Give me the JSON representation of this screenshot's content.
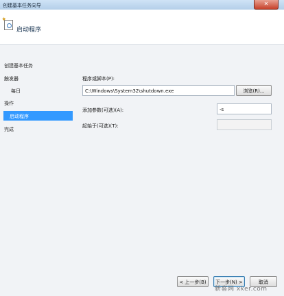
{
  "window": {
    "title": "创建基本任务向导",
    "close_glyph": "✕"
  },
  "header": {
    "heading": "启动程序"
  },
  "sidebar": {
    "items": [
      {
        "label": "创建基本任务"
      },
      {
        "label": "触发器"
      },
      {
        "label": "每日"
      },
      {
        "label": "操作"
      },
      {
        "label": "启动程序",
        "selected": true
      },
      {
        "label": "完成"
      }
    ]
  },
  "form": {
    "program_label": "程序或脚本(P):",
    "program_value": "C:\\Windows\\System32\\shutdown.exe",
    "browse_label": "浏览(R)...",
    "args_label": "添加参数(可选)(A):",
    "args_value": "-s",
    "startin_label": "起始于(可选)(T):",
    "startin_value": ""
  },
  "buttons": {
    "back": "< 上一步(B)",
    "next": "下一步(N) >",
    "cancel": "取消"
  },
  "watermark": "新客网 xker.com"
}
